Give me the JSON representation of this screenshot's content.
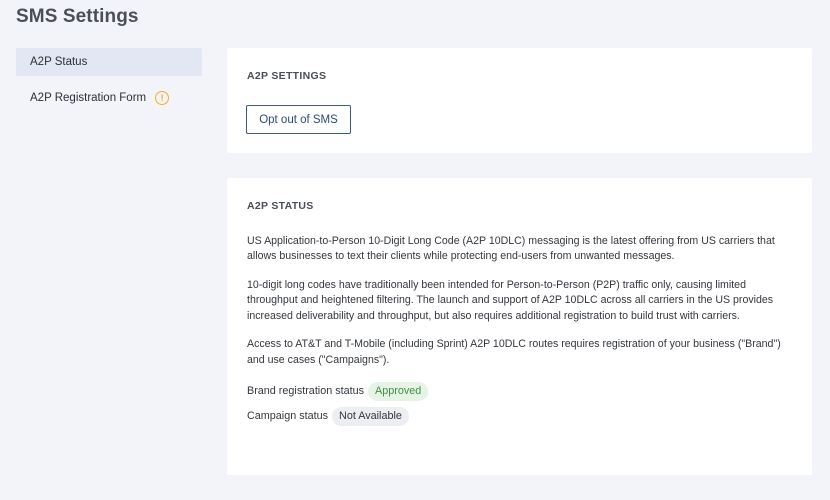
{
  "page": {
    "title": "SMS Settings"
  },
  "sidebar": {
    "items": [
      {
        "label": "A2P Status",
        "active": true
      },
      {
        "label": "A2P Registration Form",
        "icon": "warning-icon"
      }
    ]
  },
  "settings_card": {
    "heading": "A2P SETTINGS",
    "opt_out_label": "Opt out of SMS"
  },
  "status_card": {
    "heading": "A2P STATUS",
    "paragraphs": [
      "US Application-to-Person 10-Digit Long Code (A2P 10DLC) messaging is the latest offering from US carriers that allows businesses to text their clients while protecting end-users from unwanted messages.",
      "10-digit long codes have traditionally been intended for Person-to-Person (P2P) traffic only, causing limited throughput and heightened filtering. The launch and support of A2P 10DLC across all carriers in the US provides increased deliverability and throughput, but also requires additional registration to build trust with carriers.",
      "Access to AT&T and T-Mobile (including Sprint) A2P 10DLC routes requires registration of your business (\"Brand\") and use cases (\"Campaigns\")."
    ],
    "brand_label": "Brand registration status",
    "brand_status": "Approved",
    "campaign_label": "Campaign status",
    "campaign_status": "Not Available"
  },
  "colors": {
    "accent": "#2f4b78",
    "approved": "#3f8f43",
    "warning": "#f2b01e",
    "background": "#f3f4f9"
  }
}
